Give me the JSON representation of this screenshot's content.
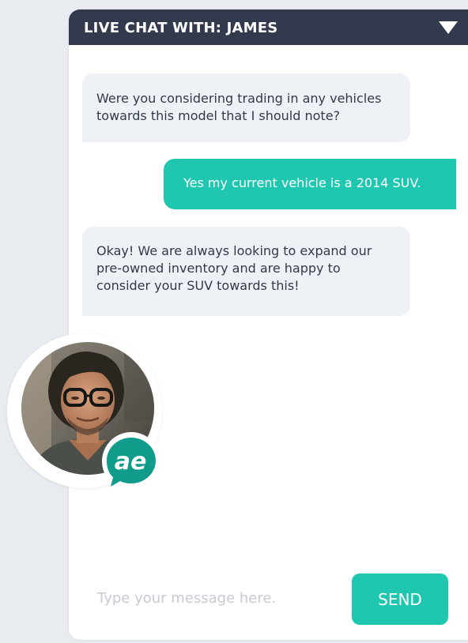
{
  "chat": {
    "title": "LIVE CHAT WITH: JAMES",
    "collapse_icon": "triangle-down-icon",
    "messages": [
      {
        "sender": "agent",
        "text": "Were you considering trading in any vehicles towards this model that I should note?"
      },
      {
        "sender": "user",
        "text": "Yes my current vehicle is a 2014 SUV."
      },
      {
        "sender": "agent",
        "text": "Okay! We are always looking to expand our pre-owned inventory and are happy to consider your SUV towards this!"
      }
    ],
    "input_placeholder": "Type your message here.",
    "input_value": "",
    "send_label": "SEND"
  },
  "agent": {
    "avatar_icon": "agent-photo",
    "badge_text": "ae",
    "badge_icon": "speech-bubble-logo"
  },
  "colors": {
    "header_bg": "#343a4e",
    "accent": "#20c7b0",
    "agent_bubble": "#eef1f5",
    "page_bg": "#e8ebf0"
  }
}
